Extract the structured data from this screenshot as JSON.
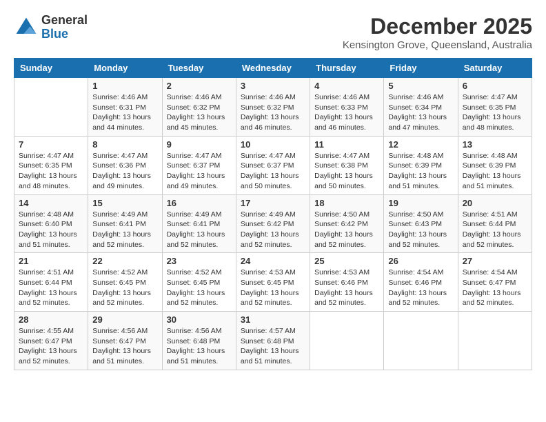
{
  "header": {
    "logo_line1": "General",
    "logo_line2": "Blue",
    "month": "December 2025",
    "location": "Kensington Grove, Queensland, Australia"
  },
  "weekdays": [
    "Sunday",
    "Monday",
    "Tuesday",
    "Wednesday",
    "Thursday",
    "Friday",
    "Saturday"
  ],
  "weeks": [
    [
      {
        "day": "",
        "info": ""
      },
      {
        "day": "1",
        "info": "Sunrise: 4:46 AM\nSunset: 6:31 PM\nDaylight: 13 hours\nand 44 minutes."
      },
      {
        "day": "2",
        "info": "Sunrise: 4:46 AM\nSunset: 6:32 PM\nDaylight: 13 hours\nand 45 minutes."
      },
      {
        "day": "3",
        "info": "Sunrise: 4:46 AM\nSunset: 6:32 PM\nDaylight: 13 hours\nand 46 minutes."
      },
      {
        "day": "4",
        "info": "Sunrise: 4:46 AM\nSunset: 6:33 PM\nDaylight: 13 hours\nand 46 minutes."
      },
      {
        "day": "5",
        "info": "Sunrise: 4:46 AM\nSunset: 6:34 PM\nDaylight: 13 hours\nand 47 minutes."
      },
      {
        "day": "6",
        "info": "Sunrise: 4:47 AM\nSunset: 6:35 PM\nDaylight: 13 hours\nand 48 minutes."
      }
    ],
    [
      {
        "day": "7",
        "info": "Sunrise: 4:47 AM\nSunset: 6:35 PM\nDaylight: 13 hours\nand 48 minutes."
      },
      {
        "day": "8",
        "info": "Sunrise: 4:47 AM\nSunset: 6:36 PM\nDaylight: 13 hours\nand 49 minutes."
      },
      {
        "day": "9",
        "info": "Sunrise: 4:47 AM\nSunset: 6:37 PM\nDaylight: 13 hours\nand 49 minutes."
      },
      {
        "day": "10",
        "info": "Sunrise: 4:47 AM\nSunset: 6:37 PM\nDaylight: 13 hours\nand 50 minutes."
      },
      {
        "day": "11",
        "info": "Sunrise: 4:47 AM\nSunset: 6:38 PM\nDaylight: 13 hours\nand 50 minutes."
      },
      {
        "day": "12",
        "info": "Sunrise: 4:48 AM\nSunset: 6:39 PM\nDaylight: 13 hours\nand 51 minutes."
      },
      {
        "day": "13",
        "info": "Sunrise: 4:48 AM\nSunset: 6:39 PM\nDaylight: 13 hours\nand 51 minutes."
      }
    ],
    [
      {
        "day": "14",
        "info": "Sunrise: 4:48 AM\nSunset: 6:40 PM\nDaylight: 13 hours\nand 51 minutes."
      },
      {
        "day": "15",
        "info": "Sunrise: 4:49 AM\nSunset: 6:41 PM\nDaylight: 13 hours\nand 52 minutes."
      },
      {
        "day": "16",
        "info": "Sunrise: 4:49 AM\nSunset: 6:41 PM\nDaylight: 13 hours\nand 52 minutes."
      },
      {
        "day": "17",
        "info": "Sunrise: 4:49 AM\nSunset: 6:42 PM\nDaylight: 13 hours\nand 52 minutes."
      },
      {
        "day": "18",
        "info": "Sunrise: 4:50 AM\nSunset: 6:42 PM\nDaylight: 13 hours\nand 52 minutes."
      },
      {
        "day": "19",
        "info": "Sunrise: 4:50 AM\nSunset: 6:43 PM\nDaylight: 13 hours\nand 52 minutes."
      },
      {
        "day": "20",
        "info": "Sunrise: 4:51 AM\nSunset: 6:44 PM\nDaylight: 13 hours\nand 52 minutes."
      }
    ],
    [
      {
        "day": "21",
        "info": "Sunrise: 4:51 AM\nSunset: 6:44 PM\nDaylight: 13 hours\nand 52 minutes."
      },
      {
        "day": "22",
        "info": "Sunrise: 4:52 AM\nSunset: 6:45 PM\nDaylight: 13 hours\nand 52 minutes."
      },
      {
        "day": "23",
        "info": "Sunrise: 4:52 AM\nSunset: 6:45 PM\nDaylight: 13 hours\nand 52 minutes."
      },
      {
        "day": "24",
        "info": "Sunrise: 4:53 AM\nSunset: 6:45 PM\nDaylight: 13 hours\nand 52 minutes."
      },
      {
        "day": "25",
        "info": "Sunrise: 4:53 AM\nSunset: 6:46 PM\nDaylight: 13 hours\nand 52 minutes."
      },
      {
        "day": "26",
        "info": "Sunrise: 4:54 AM\nSunset: 6:46 PM\nDaylight: 13 hours\nand 52 minutes."
      },
      {
        "day": "27",
        "info": "Sunrise: 4:54 AM\nSunset: 6:47 PM\nDaylight: 13 hours\nand 52 minutes."
      }
    ],
    [
      {
        "day": "28",
        "info": "Sunrise: 4:55 AM\nSunset: 6:47 PM\nDaylight: 13 hours\nand 52 minutes."
      },
      {
        "day": "29",
        "info": "Sunrise: 4:56 AM\nSunset: 6:47 PM\nDaylight: 13 hours\nand 51 minutes."
      },
      {
        "day": "30",
        "info": "Sunrise: 4:56 AM\nSunset: 6:48 PM\nDaylight: 13 hours\nand 51 minutes."
      },
      {
        "day": "31",
        "info": "Sunrise: 4:57 AM\nSunset: 6:48 PM\nDaylight: 13 hours\nand 51 minutes."
      },
      {
        "day": "",
        "info": ""
      },
      {
        "day": "",
        "info": ""
      },
      {
        "day": "",
        "info": ""
      }
    ]
  ]
}
